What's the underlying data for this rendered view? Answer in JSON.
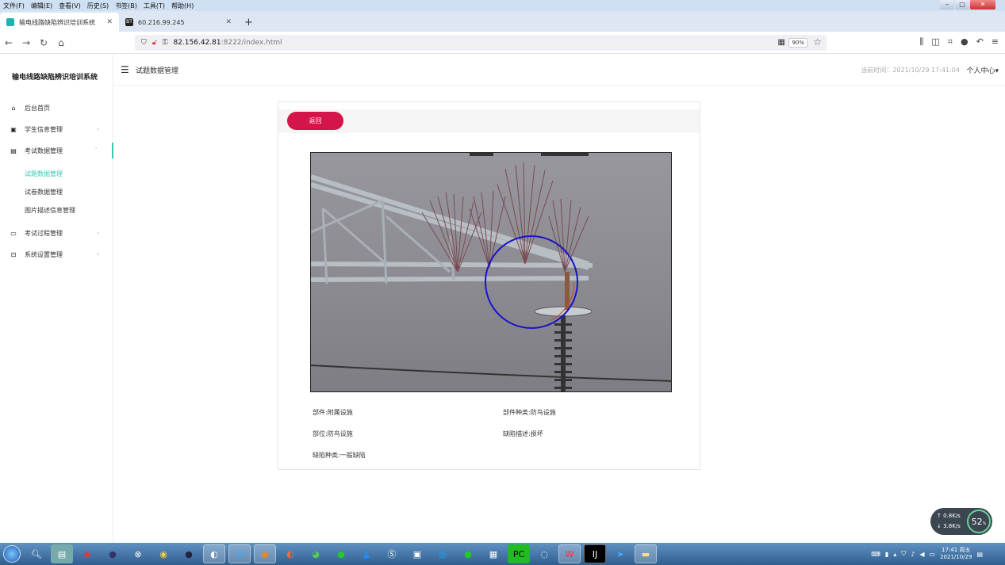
{
  "browser": {
    "menu": [
      "文件(F)",
      "编辑(E)",
      "查看(V)",
      "历史(S)",
      "书签(B)",
      "工具(T)",
      "帮助(H)"
    ],
    "tabs": [
      {
        "label": "输电线路缺陷辨识培训系统",
        "active": true
      },
      {
        "label": "60.216.99.245",
        "active": false
      }
    ],
    "url_host": "82.156.42.81",
    "url_rest": ":8222/index.html",
    "zoom": "90%"
  },
  "app": {
    "title": "输电线路缺陷辨识培训系统",
    "breadcrumb": "试题数据管理",
    "time_label": "当前时间：2021/10/29 17:41:04",
    "user_menu": "个人中心"
  },
  "sidebar": {
    "items": [
      {
        "label": "后台首页",
        "icon": "home-icon",
        "glyph": "⌂"
      },
      {
        "label": "学生信息管理",
        "icon": "id-card-icon",
        "glyph": "▣",
        "arrow": "›"
      },
      {
        "label": "考试数据管理",
        "icon": "document-icon",
        "glyph": "▤",
        "arrow": "ˇ"
      },
      {
        "label": "考试过程管理",
        "icon": "monitor-icon",
        "glyph": "▭",
        "arrow": "›"
      },
      {
        "label": "系统设置管理",
        "icon": "lock-icon",
        "glyph": "⊡",
        "arrow": "›"
      }
    ],
    "sub_items": [
      "试题数据管理",
      "试卷数据管理",
      "图片描述信息管理"
    ]
  },
  "detail": {
    "back_label": "返回",
    "fields": [
      "部件:附属设施",
      "部件种类:防鸟设施",
      "部位:防鸟设施",
      "缺陷描述:损坏",
      "缺陷种类:一般缺陷"
    ]
  },
  "widget": {
    "up": "0.8K/s",
    "down": "3.8K/s",
    "percent": "52"
  },
  "taskbar": {
    "clock_time": "17:41 周五",
    "clock_date": "2021/10/29"
  }
}
